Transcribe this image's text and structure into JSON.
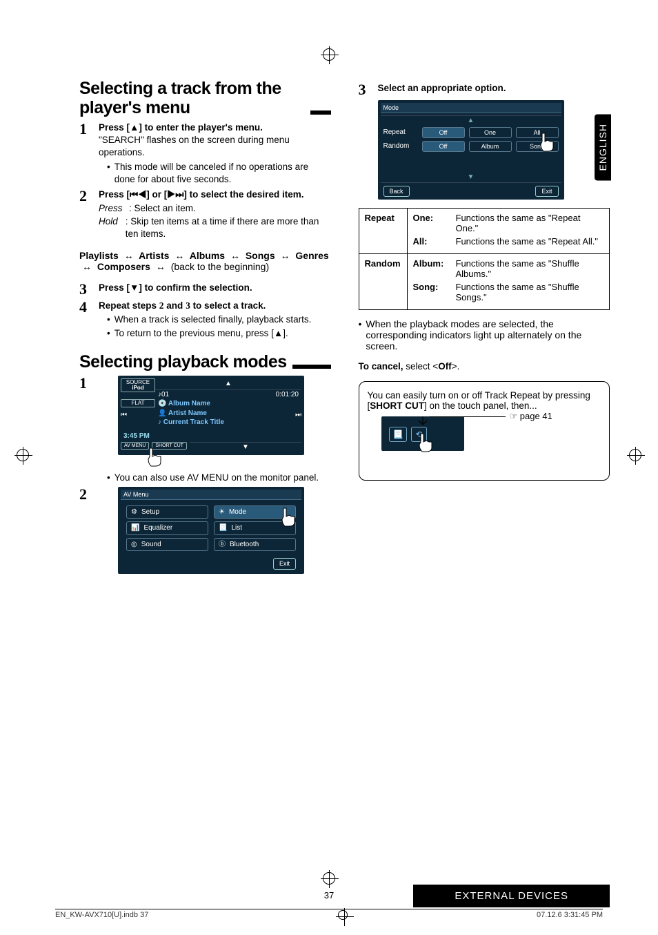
{
  "page_number": "37",
  "language_tab": "ENGLISH",
  "footer_bar": "EXTERNAL DEVICES",
  "print_footer": {
    "left": "EN_KW-AVX710[U].indb   37",
    "right": "07.12.6   3:31:45 PM"
  },
  "left_col": {
    "h_select_track": "Selecting a track from the player's menu",
    "step1": {
      "bold": "Press [▲] to enter the player's menu.",
      "text": "\"SEARCH\" flashes on the screen during menu operations.",
      "bullet": "This mode will be canceled if no operations are done for about five seconds."
    },
    "step2": {
      "bold": "Press [⏮◀] or [▶⏭] to select the desired item.",
      "press_label": "Press",
      "press_text": ": Select an item.",
      "hold_label": "Hold",
      "hold_text": ": Skip ten items at a time if there are more than ten items."
    },
    "nav": {
      "items": [
        "Playlists",
        "Artists",
        "Albums",
        "Songs",
        "Genres",
        "Composers"
      ],
      "tail": "(back to the beginning)"
    },
    "step3": {
      "bold": "Press [▼] to confirm the selection."
    },
    "step4": {
      "bold_a": "Repeat steps ",
      "bold_b": " and ",
      "bold_c": " to select a track.",
      "n1": "2",
      "n2": "3",
      "bullet1": "When a track is selected finally, playback starts.",
      "bullet2": "To return to the previous menu, press [▲]."
    },
    "h_playback_modes": "Selecting playback modes",
    "ipod_screen": {
      "source_label": "SOURCE",
      "source_value": "iPod",
      "track": "♪01",
      "time": "0:01:20",
      "album": "Album Name",
      "artist": "Artist Name",
      "title": "Current Track Title",
      "clock": "3:45 PM",
      "flat": "FLAT",
      "avmenu": "AV MENU",
      "shortcut": "SHORT CUT"
    },
    "ipod_note": "You can also use AV MENU on the monitor panel.",
    "avmenu_screen": {
      "title": "AV Menu",
      "items_left": [
        "Setup",
        "Equalizer",
        "Sound"
      ],
      "items_right": [
        "Mode",
        "List",
        "Bluetooth"
      ],
      "exit": "Exit"
    }
  },
  "right_col": {
    "step3": {
      "bold": "Select an appropriate option."
    },
    "mode_screen": {
      "title": "Mode",
      "rows": [
        {
          "label": "Repeat",
          "opts": [
            "Off",
            "One",
            "All"
          ],
          "selected": 0
        },
        {
          "label": "Random",
          "opts": [
            "Off",
            "Album",
            "Song"
          ],
          "selected": 0
        }
      ],
      "back": "Back",
      "exit": "Exit"
    },
    "def_table": {
      "repeat": {
        "label": "Repeat",
        "rows": [
          {
            "k": "One:",
            "v": "Functions the same as \"Repeat One.\""
          },
          {
            "k": "All:",
            "v": "Functions the same as \"Repeat All.\""
          }
        ]
      },
      "random": {
        "label": "Random",
        "rows": [
          {
            "k": "Album:",
            "v": "Functions the same as \"Shuffle Albums.\""
          },
          {
            "k": "Song:",
            "v": "Functions the same as \"Shuffle Songs.\""
          }
        ]
      }
    },
    "post_bullet": "When the playback modes are selected, the corresponding indicators light up alternately on the screen.",
    "cancel_line_a": "To cancel,",
    "cancel_line_b": " select <",
    "cancel_line_c": "Off",
    "cancel_line_d": ">.",
    "callout": {
      "line1a": "You can easily turn on or off Track Repeat by pressing [",
      "line1b": "SHORT CUT",
      "line1c": "] on the touch panel, then...",
      "page_ref": "☞ page 41"
    }
  }
}
